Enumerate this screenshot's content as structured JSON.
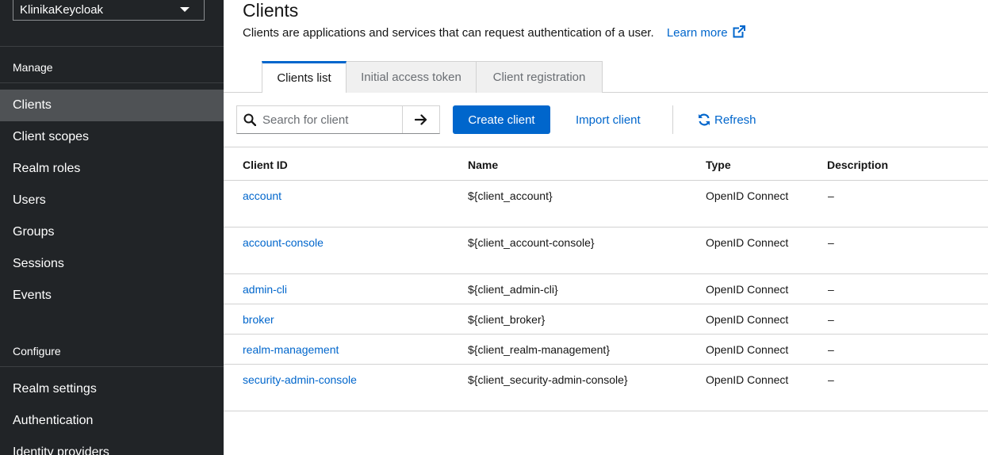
{
  "sidebar": {
    "realm": "KlinikaKeycloak",
    "sections": {
      "manage": "Manage",
      "configure": "Configure"
    },
    "manage_items": [
      {
        "label": "Clients"
      },
      {
        "label": "Client scopes"
      },
      {
        "label": "Realm roles"
      },
      {
        "label": "Users"
      },
      {
        "label": "Groups"
      },
      {
        "label": "Sessions"
      },
      {
        "label": "Events"
      }
    ],
    "configure_items": [
      {
        "label": "Realm settings"
      },
      {
        "label": "Authentication"
      },
      {
        "label": "Identity providers"
      }
    ]
  },
  "header": {
    "title": "Clients",
    "description": "Clients are applications and services that can request authentication of a user.",
    "learn_more": "Learn more"
  },
  "tabs": [
    {
      "label": "Clients list",
      "active": true
    },
    {
      "label": "Initial access token",
      "active": false
    },
    {
      "label": "Client registration",
      "active": false
    }
  ],
  "toolbar": {
    "search_placeholder": "Search for client",
    "create_label": "Create client",
    "import_label": "Import client",
    "refresh_label": "Refresh"
  },
  "table": {
    "columns": [
      "Client ID",
      "Name",
      "Type",
      "Description"
    ],
    "rows": [
      {
        "client_id": "account",
        "name": "${client_account}",
        "type": "OpenID Connect",
        "description": "–"
      },
      {
        "client_id": "account-console",
        "name": "${client_account-console}",
        "type": "OpenID Connect",
        "description": "–"
      },
      {
        "client_id": "admin-cli",
        "name": "${client_admin-cli}",
        "type": "OpenID Connect",
        "description": "–"
      },
      {
        "client_id": "broker",
        "name": "${client_broker}",
        "type": "OpenID Connect",
        "description": "–"
      },
      {
        "client_id": "realm-management",
        "name": "${client_realm-management}",
        "type": "OpenID Connect",
        "description": "–"
      },
      {
        "client_id": "security-admin-console",
        "name": "${client_security-admin-console}",
        "type": "OpenID Connect",
        "description": "–"
      }
    ]
  },
  "colors": {
    "accent": "#0066cc",
    "sidebar_bg": "#212427",
    "sidebar_active": "#4f5255"
  }
}
